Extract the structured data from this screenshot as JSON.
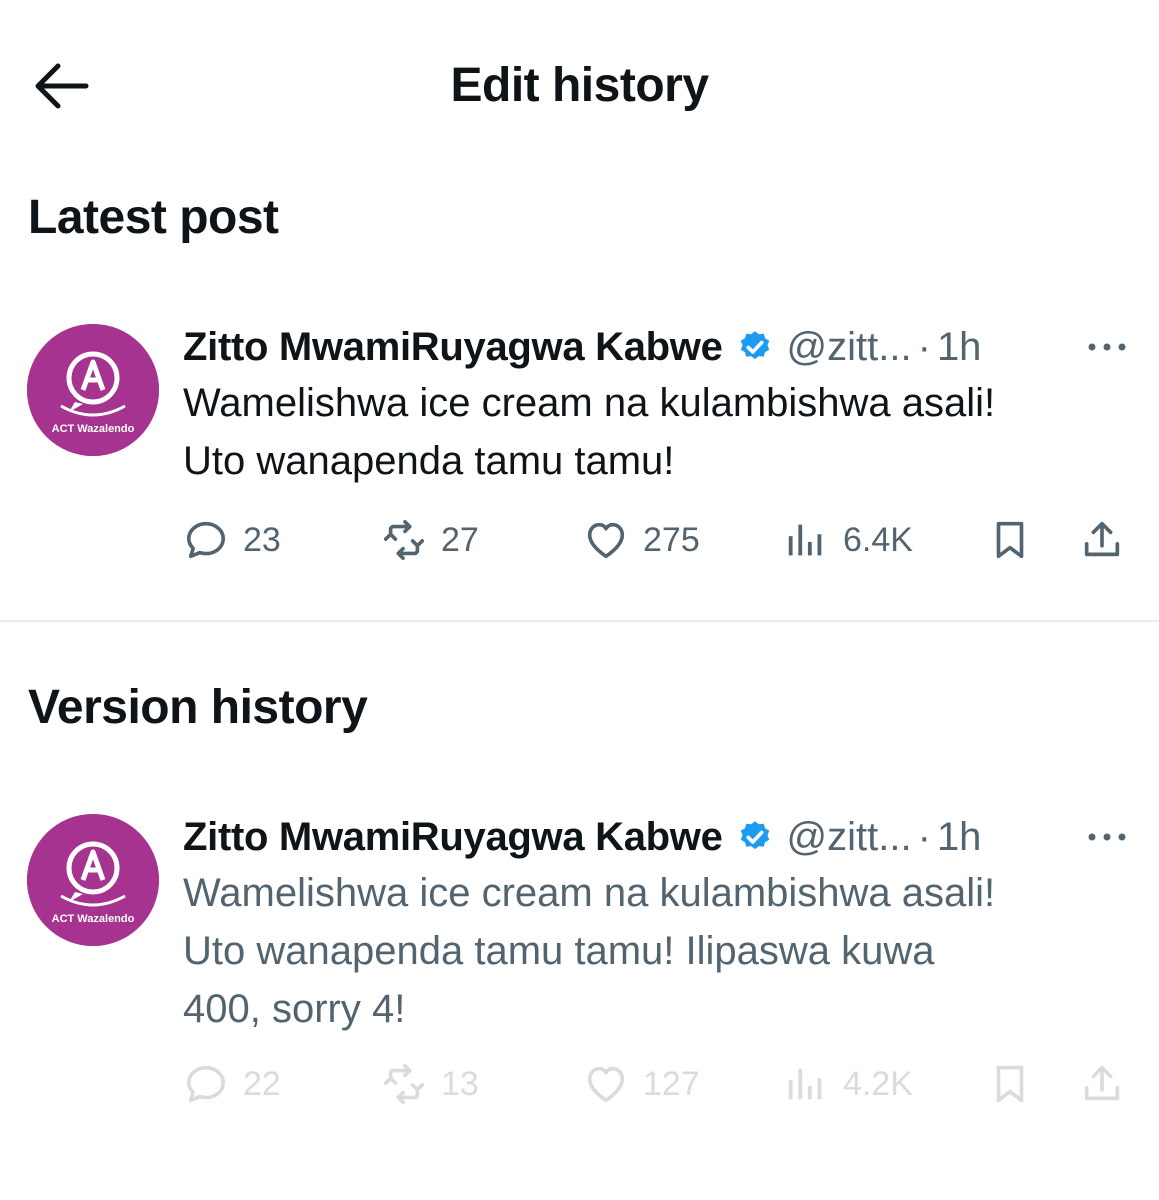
{
  "header": {
    "title": "Edit history",
    "back_icon": "arrow-left-icon"
  },
  "sections": {
    "latest": "Latest post",
    "history": "Version history"
  },
  "avatar": {
    "org_label": "ACT Wazalendo",
    "color": "#a5338f"
  },
  "posts": [
    {
      "author": "Zitto MwamiRuyagwa Kabwe",
      "handle": "@zitt...",
      "separator": "·",
      "time": "1h",
      "text_line1": "Wamelishwa ice cream na kulambishwa asali!",
      "text_line2": "Uto wanapenda tamu tamu!",
      "text_line3": "",
      "replies": "23",
      "reposts": "27",
      "likes": "275",
      "views": "6.4K"
    },
    {
      "author": "Zitto MwamiRuyagwa Kabwe",
      "handle": "@zitt...",
      "separator": "·",
      "time": "1h",
      "text_line1": "Wamelishwa ice cream na kulambishwa asali!",
      "text_line2": "Uto wanapenda tamu tamu! Ilipaswa kuwa",
      "text_line3": "400, sorry 4!",
      "replies": "22",
      "reposts": "13",
      "likes": "127",
      "views": "4.2K"
    }
  ],
  "colors": {
    "verified": "#1d9bf0",
    "secondary_text": "#536471",
    "primary_text": "#0f1419"
  }
}
